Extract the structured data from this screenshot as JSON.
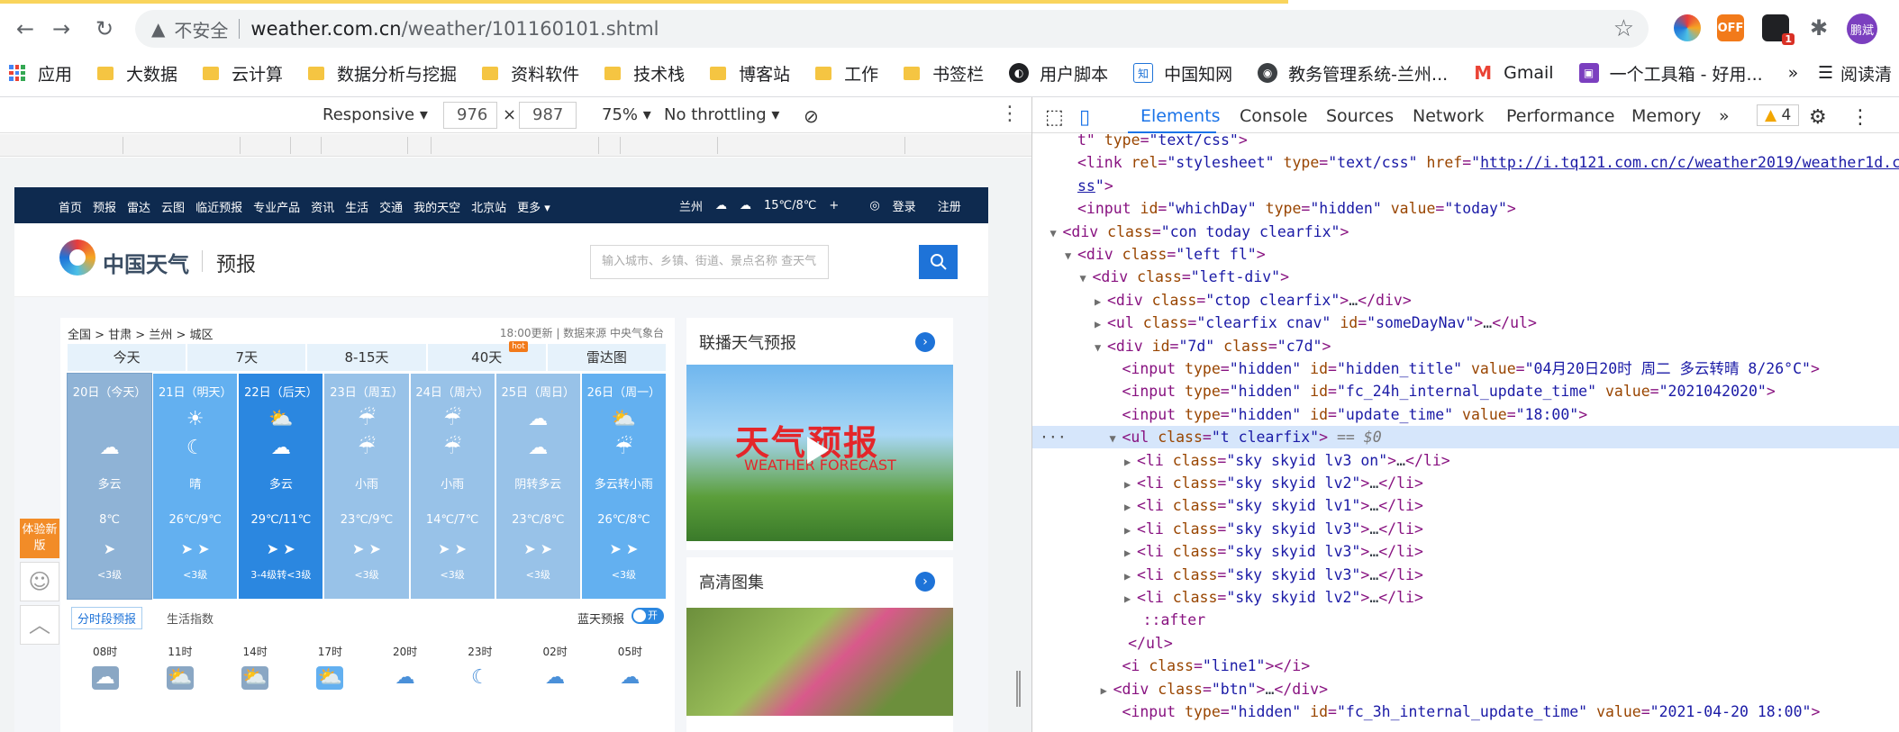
{
  "browser": {
    "security_label": "不安全",
    "url_host": "weather.com.cn",
    "url_path": "/weather/101160101.shtml",
    "extensions": [
      {
        "name": "colorful-extension",
        "label": ""
      },
      {
        "name": "off-extension",
        "label": "OFF"
      },
      {
        "name": "notes-extension",
        "label": "1"
      }
    ],
    "profile_name": "鹏斌",
    "bookmarks": [
      "应用",
      "大数据",
      "云计算",
      "数据分析与挖掘",
      "资料软件",
      "技术栈",
      "博客站",
      "工作",
      "书签栏",
      "用户脚本",
      "中国知网",
      "教务管理系统-兰州...",
      "Gmail",
      "一个工具箱 - 好用..."
    ],
    "bookmarks_more": "»",
    "reading_list": "阅读清"
  },
  "device_toolbar": {
    "mode": "Responsive",
    "width": "976",
    "times": "×",
    "height": "987",
    "zoom": "75%",
    "throttling": "No throttling"
  },
  "devtools": {
    "tabs": [
      "Elements",
      "Console",
      "Sources",
      "Network",
      "Performance",
      "Memory"
    ],
    "active_tab": "Elements",
    "warnings": "4",
    "dom_lines": [
      {
        "indent": 0,
        "html": "t\" <span class='an'>type</span>=<span class='av'>\"text/css\"</span>&gt;"
      },
      {
        "indent": 0,
        "html": "&lt;link <span class='an'>rel</span>=<span class='av'>\"stylesheet\"</span> <span class='an'>type</span>=<span class='av'>\"text/css\"</span> <span class='an'>href</span>=<span class='av'>\"</span><span class='lk'>http://i.tq121.com.cn/c/weather2019/weather1d.c</span>"
      },
      {
        "indent": 0,
        "html": "<span class='lk'>ss</span><span class='av'>\"</span>&gt;"
      },
      {
        "indent": 0,
        "html": "&lt;input <span class='an'>id</span>=<span class='av'>\"whichDay\"</span> <span class='an'>type</span>=<span class='av'>\"hidden\"</span> <span class='an'>value</span>=<span class='av'>\"today\"</span>&gt;"
      },
      {
        "indent": -1,
        "tri": "▼",
        "html": "&lt;div <span class='an'>class</span>=<span class='av'>\"con today clearfix\"</span>&gt;"
      },
      {
        "indent": 0,
        "tri": "▼",
        "html": "&lt;div <span class='an'>class</span>=<span class='av'>\"left fl\"</span>&gt;"
      },
      {
        "indent": 1,
        "tri": "▼",
        "html": "&lt;div <span class='an'>class</span>=<span class='av'>\"left-div\"</span>&gt;"
      },
      {
        "indent": 2,
        "tri": "▶",
        "html": "&lt;div <span class='an'>class</span>=<span class='av'>\"ctop clearfix\"</span>&gt;<span class='tx'>…</span>&lt;/div&gt;"
      },
      {
        "indent": 2,
        "tri": "▶",
        "html": "&lt;ul <span class='an'>class</span>=<span class='av'>\"clearfix cnav\"</span> <span class='an'>id</span>=<span class='av'>\"someDayNav\"</span>&gt;<span class='tx'>…</span>&lt;/ul&gt;"
      },
      {
        "indent": 2,
        "tri": "▼",
        "html": "&lt;div <span class='an'>id</span>=<span class='av'>\"7d\"</span> <span class='an'>class</span>=<span class='av'>\"c7d\"</span>&gt;"
      },
      {
        "indent": 3,
        "html": "&lt;input <span class='an'>type</span>=<span class='av'>\"hidden\"</span> <span class='an'>id</span>=<span class='av'>\"hidden_title\"</span> <span class='an'>value</span>=<span class='av'>\"04月20日20时 周二  多云转晴  8/26°C\"</span>&gt;"
      },
      {
        "indent": 3,
        "html": "&lt;input <span class='an'>type</span>=<span class='av'>\"hidden\"</span> <span class='an'>id</span>=<span class='av'>\"fc_24h_internal_update_time\"</span> <span class='an'>value</span>=<span class='av'>\"2021042020\"</span>&gt;"
      },
      {
        "indent": 3,
        "html": "&lt;input <span class='an'>type</span>=<span class='av'>\"hidden\"</span> <span class='an'>id</span>=<span class='av'>\"update_time\"</span> <span class='an'>value</span>=<span class='av'>\"18:00\"</span>&gt;"
      },
      {
        "indent": 3,
        "tri": "▼",
        "sel": true,
        "html": "&lt;ul <span class='an'>class</span>=<span class='av'>\"t clearfix\"</span>&gt; <span class='dim'>== $0</span>"
      },
      {
        "indent": 4,
        "tri": "▶",
        "html": "&lt;li <span class='an'>class</span>=<span class='av'>\"sky skyid lv3 on\"</span>&gt;<span class='tx'>…</span>&lt;/li&gt;"
      },
      {
        "indent": 4,
        "tri": "▶",
        "html": "&lt;li <span class='an'>class</span>=<span class='av'>\"sky skyid lv2\"</span>&gt;<span class='tx'>…</span>&lt;/li&gt;"
      },
      {
        "indent": 4,
        "tri": "▶",
        "html": "&lt;li <span class='an'>class</span>=<span class='av'>\"sky skyid lv1\"</span>&gt;<span class='tx'>…</span>&lt;/li&gt;"
      },
      {
        "indent": 4,
        "tri": "▶",
        "html": "&lt;li <span class='an'>class</span>=<span class='av'>\"sky skyid lv3\"</span>&gt;<span class='tx'>…</span>&lt;/li&gt;"
      },
      {
        "indent": 4,
        "tri": "▶",
        "html": "&lt;li <span class='an'>class</span>=<span class='av'>\"sky skyid lv3\"</span>&gt;<span class='tx'>…</span>&lt;/li&gt;"
      },
      {
        "indent": 4,
        "tri": "▶",
        "html": "&lt;li <span class='an'>class</span>=<span class='av'>\"sky skyid lv3\"</span>&gt;<span class='tx'>…</span>&lt;/li&gt;"
      },
      {
        "indent": 4,
        "tri": "▶",
        "html": "&lt;li <span class='an'>class</span>=<span class='av'>\"sky skyid lv2\"</span>&gt;<span class='tx'>…</span>&lt;/li&gt;"
      },
      {
        "indent": 4.4,
        "html": "<span class='ps'>::after</span>"
      },
      {
        "indent": 3.4,
        "html": "&lt;/ul&gt;"
      },
      {
        "indent": 3,
        "html": "&lt;i <span class='an'>class</span>=<span class='av'>\"line1\"</span>&gt;&lt;/i&gt;"
      },
      {
        "indent": 2.4,
        "tri": "▶",
        "html": "&lt;div <span class='an'>class</span>=<span class='av'>\"btn\"</span>&gt;<span class='tx'>…</span>&lt;/div&gt;"
      },
      {
        "indent": 3,
        "html": "&lt;input <span class='an'>type</span>=<span class='av'>\"hidden\"</span> <span class='an'>id</span>=<span class='av'>\"fc_3h_internal_update_time\"</span> <span class='an'>value</span>=<span class='av'>\"2021-04-20 18:00\"</span>&gt;"
      }
    ]
  },
  "site": {
    "nav_links": [
      "首页",
      "预报",
      "雷达",
      "云图",
      "临近预报",
      "专业产品",
      "资讯",
      "生活",
      "交通",
      "我的天空",
      "北京站",
      "更多 ▾"
    ],
    "city": "兰州",
    "current_temp": "15℃/8℃",
    "login": "登录",
    "register": "注册",
    "logo_text": "中国天气",
    "logo_sub": "预报",
    "search_placeholder": "输入城市、乡镇、街道、景点名称 查天气",
    "breadcrumb": "全国 > 甘肃 > 兰州 > 城区",
    "update_info": "18:00更新 | 数据来源 中央气象台",
    "day_tabs": [
      {
        "label": "今天",
        "active": true
      },
      {
        "label": "7天"
      },
      {
        "label": "8-15天"
      },
      {
        "label": "40天",
        "hot": "hot"
      },
      {
        "label": "雷达图"
      }
    ],
    "forecast": [
      {
        "day": "20日（今天）",
        "icon1": "",
        "icon2": "☁",
        "weather": "多云",
        "temp": "8℃",
        "wind": "➤",
        "level": "<3级",
        "color": "#8fb3d6"
      },
      {
        "day": "21日（明天）",
        "icon1": "☀",
        "icon2": "☾",
        "weather": "晴",
        "temp": "26℃/9℃",
        "wind": "➤ ➤",
        "level": "<3级",
        "color": "#63b0f0"
      },
      {
        "day": "22日（后天）",
        "icon1": "⛅",
        "icon2": "☁",
        "weather": "多云",
        "temp": "29℃/11℃",
        "wind": "➤ ➤",
        "level": "3-4级转<3级",
        "color": "#2b87e0"
      },
      {
        "day": "23日（周五）",
        "icon1": "☔",
        "icon2": "☔",
        "weather": "小雨",
        "temp": "23℃/9℃",
        "wind": "➤ ➤",
        "level": "<3级",
        "color": "#98c2e8"
      },
      {
        "day": "24日（周六）",
        "icon1": "☔",
        "icon2": "☔",
        "weather": "小雨",
        "temp": "14℃/7℃",
        "wind": "➤ ➤",
        "level": "<3级",
        "color": "#98c2e8"
      },
      {
        "day": "25日（周日）",
        "icon1": "☁",
        "icon2": "☁",
        "weather": "阴转多云",
        "temp": "23℃/8℃",
        "wind": "➤ ➤",
        "level": "<3级",
        "color": "#98c2e8"
      },
      {
        "day": "26日（周一）",
        "icon1": "⛅",
        "icon2": "☔",
        "weather": "多云转小雨",
        "temp": "26℃/8℃",
        "wind": "➤ ➤",
        "level": "<3级",
        "color": "#63b0f0"
      }
    ],
    "sub_tab_active": "分时段预报",
    "sub_tab_other": "生活指数",
    "blue_sky_label": "蓝天预报",
    "toggle_label": "开",
    "hours": [
      {
        "t": "08时",
        "ic": "☁"
      },
      {
        "t": "11时",
        "ic": "⛅"
      },
      {
        "t": "14时",
        "ic": "⛅"
      },
      {
        "t": "17时",
        "ic": "⛅"
      },
      {
        "t": "20时",
        "ic": "☁"
      },
      {
        "t": "23时",
        "ic": "☾"
      },
      {
        "t": "02时",
        "ic": "☁"
      },
      {
        "t": "05时",
        "ic": "☁"
      }
    ],
    "side_title_1": "联播天气预报",
    "side_title_2": "高清图集",
    "video_title": "天气预报",
    "video_sub": "WEATHER FORECAST",
    "float_tag": "体验新版"
  }
}
